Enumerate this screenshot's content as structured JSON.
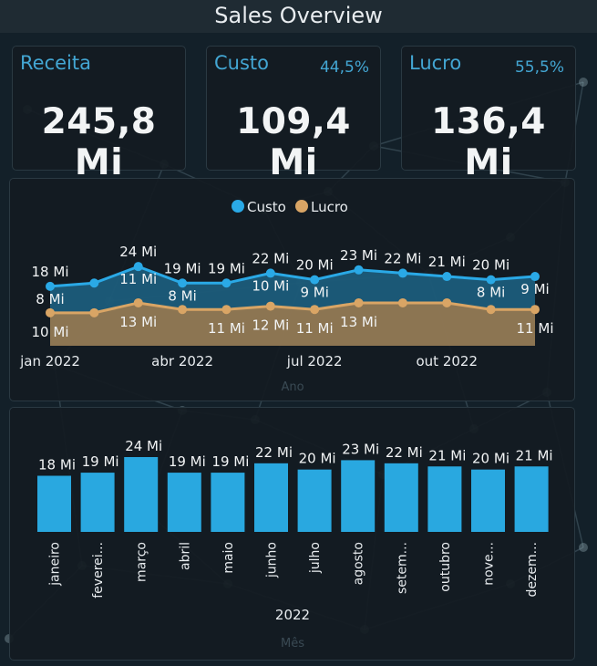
{
  "page_title": "Sales Overview",
  "colors": {
    "background": "#132029",
    "accent": "#43a6d3",
    "custo": "#2aa9e6",
    "lucro": "#d9a565",
    "bar": "#29a8e0"
  },
  "kpis": [
    {
      "label": "Receita",
      "value": "245,8 Mi",
      "pct": ""
    },
    {
      "label": "Custo",
      "value": "109,4 Mi",
      "pct": "44,5%"
    },
    {
      "label": "Lucro",
      "value": "136,4 Mi",
      "pct": "55,5%"
    }
  ],
  "chart_data": [
    {
      "type": "area",
      "title": "",
      "xlabel": "Ano",
      "ylabel": "",
      "x_ticks": [
        "jan 2022",
        "abr 2022",
        "jul 2022",
        "out 2022"
      ],
      "x": [
        "2022-01",
        "2022-02",
        "2022-03",
        "2022-04",
        "2022-05",
        "2022-06",
        "2022-07",
        "2022-08",
        "2022-09",
        "2022-10",
        "2022-11",
        "2022-12"
      ],
      "legend_position": "top-center",
      "series": [
        {
          "name": "Custo",
          "values": [
            18,
            19,
            24,
            19,
            19,
            22,
            20,
            23,
            22,
            21,
            20,
            21
          ],
          "labels": [
            "18 Mi",
            "",
            "24 Mi",
            "19 Mi",
            "19 Mi",
            "22 Mi",
            "20 Mi",
            "23 Mi",
            "22 Mi",
            "21 Mi",
            "20 Mi",
            ""
          ]
        },
        {
          "name": "Lucro",
          "values": [
            10,
            10,
            13,
            11,
            11,
            12,
            11,
            13,
            13,
            13,
            11,
            11
          ],
          "labels": [
            "10 Mi",
            "",
            "13 Mi",
            "",
            "11 Mi",
            "12 Mi",
            "11 Mi",
            "13 Mi",
            "",
            "",
            "",
            "11 Mi"
          ]
        }
      ],
      "extra_labels": [
        "8 Mi",
        "11 Mi",
        "8 Mi",
        "10 Mi",
        "9 Mi",
        "8 Mi",
        "9 Mi"
      ]
    },
    {
      "type": "bar",
      "title": "",
      "xlabel": "Mês",
      "group_label": "2022",
      "ylabel": "",
      "categories": [
        "janeiro",
        "feverei...",
        "março",
        "abril",
        "maio",
        "junho",
        "julho",
        "agosto",
        "setem...",
        "outubro",
        "nove...",
        "dezem..."
      ],
      "values": [
        18,
        19,
        24,
        19,
        19,
        22,
        20,
        23,
        22,
        21,
        20,
        21
      ],
      "value_labels": [
        "18 Mi",
        "19 Mi",
        "24 Mi",
        "19 Mi",
        "19 Mi",
        "22 Mi",
        "20 Mi",
        "23 Mi",
        "22 Mi",
        "21 Mi",
        "20 Mi",
        "21 Mi"
      ]
    }
  ]
}
